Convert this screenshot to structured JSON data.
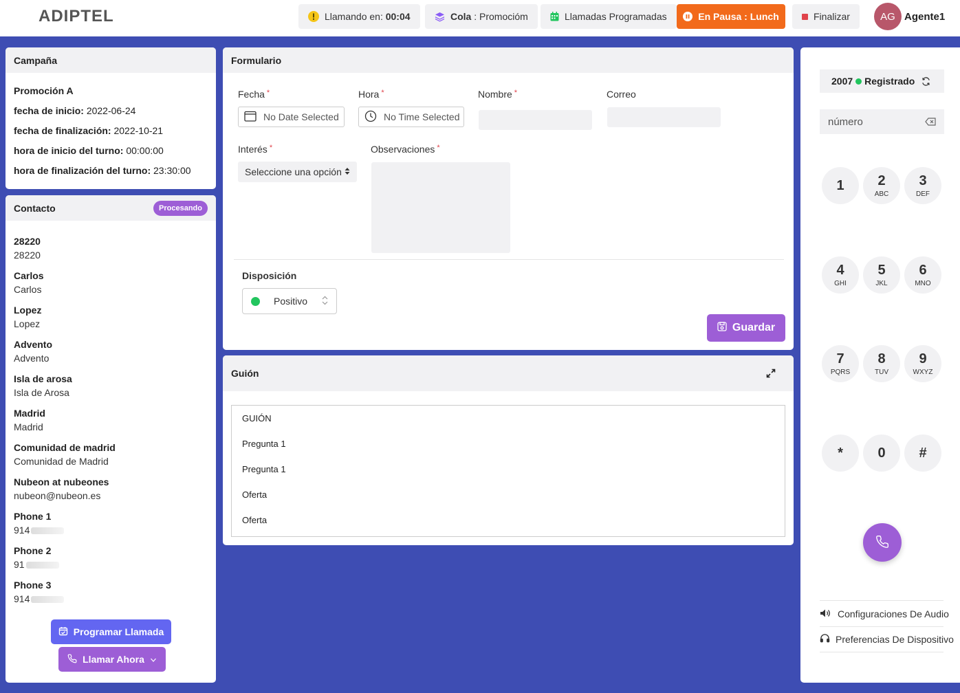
{
  "brand": "ADIPTEL",
  "topbar": {
    "calling_label": "Llamando en:",
    "calling_time": "00:04",
    "queue_label": "Cola",
    "queue_value": "Promocióm",
    "scheduled_label": "Llamadas Programadas",
    "pause_label": "En Pausa",
    "pause_value": "Lunch",
    "finish_label": "Finalizar",
    "avatar_initials": "AG",
    "agent_name": "Agente1"
  },
  "campaign": {
    "title": "Campaña",
    "name": "Promoción A",
    "rows": [
      {
        "label": "fecha de inicio:",
        "value": "2022-06-24"
      },
      {
        "label": "fecha de finalización:",
        "value": "2022-10-21"
      },
      {
        "label": "hora de inicio del turno:",
        "value": "00:00:00"
      },
      {
        "label": "hora de finalización del turno:",
        "value": "23:30:00"
      }
    ]
  },
  "contact": {
    "title": "Contacto",
    "status": "Procesando",
    "items": [
      {
        "k": "28220",
        "v": "28220"
      },
      {
        "k": "Carlos",
        "v": "Carlos"
      },
      {
        "k": "Lopez",
        "v": "Lopez"
      },
      {
        "k": "Advento",
        "v": "Advento"
      },
      {
        "k": "Isla de arosa",
        "v": "Isla de Arosa"
      },
      {
        "k": "Madrid",
        "v": "Madrid"
      },
      {
        "k": "Comunidad de madrid",
        "v": "Comunidad de Madrid"
      },
      {
        "k": "Nubeon at nubeones",
        "v": "nubeon@nubeon.es"
      },
      {
        "k": "Phone 1",
        "v": "914"
      },
      {
        "k": "Phone 2",
        "v": "91"
      },
      {
        "k": "Phone 3",
        "v": "914"
      }
    ],
    "schedule_button": "Programar Llamada",
    "call_now_button": "Llamar Ahora"
  },
  "form": {
    "title": "Formulario",
    "date_label": "Fecha",
    "date_placeholder": "No Date Selected",
    "time_label": "Hora",
    "time_placeholder": "No Time Selected",
    "name_label": "Nombre",
    "email_label": "Correo",
    "interest_label": "Interés",
    "interest_value": "Seleccione una opción",
    "notes_label": "Observaciones",
    "disposition_label": "Disposición",
    "disposition_value": "Positivo",
    "save_button": "Guardar",
    "required_mark": "*"
  },
  "script": {
    "title": "Guión",
    "lines": [
      "GUIÓN",
      "Pregunta 1",
      "Pregunta 1",
      "Oferta",
      "Oferta"
    ]
  },
  "dialer": {
    "extension": "2007",
    "status": "Registrado",
    "number_placeholder": "número",
    "keys": [
      {
        "n": "1",
        "l": ""
      },
      {
        "n": "2",
        "l": "ABC"
      },
      {
        "n": "3",
        "l": "DEF"
      },
      {
        "n": "4",
        "l": "GHI"
      },
      {
        "n": "5",
        "l": "JKL"
      },
      {
        "n": "6",
        "l": "MNO"
      },
      {
        "n": "7",
        "l": "PQRS"
      },
      {
        "n": "8",
        "l": "TUV"
      },
      {
        "n": "9",
        "l": "WXYZ"
      },
      {
        "n": "*",
        "l": ""
      },
      {
        "n": "0",
        "l": ""
      },
      {
        "n": "#",
        "l": ""
      }
    ],
    "audio_settings": "Configuraciones De Audio",
    "device_prefs": "Preferencias De Dispositivo"
  },
  "colors": {
    "background": "#3e4db3",
    "accent_purple": "#9d5ed6",
    "indigo": "#6366f1",
    "pause_orange": "#f26a1b",
    "registered_green": "#22c55e"
  }
}
